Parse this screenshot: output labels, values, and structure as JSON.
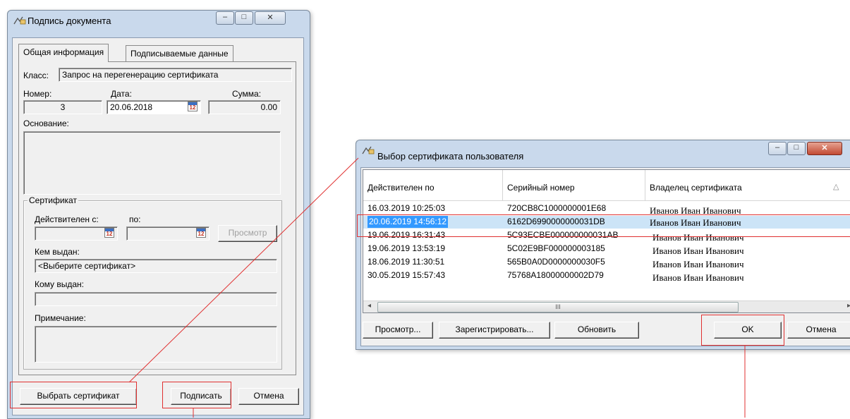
{
  "sign_dialog": {
    "title": "Подпись документа",
    "tabs": [
      "Общая информация",
      "Подписываемые данные"
    ],
    "class_label": "Класс:",
    "class_value": "Запрос на перегенерацию сертификата",
    "number_label": "Номер:",
    "number_value": "3",
    "date_label": "Дата:",
    "date_value": "20.06.2018",
    "sum_label": "Сумма:",
    "sum_value": "0.00",
    "basis_label": "Основание:",
    "cert_group_title": "Сертификат",
    "valid_from_label": "Действителен с:",
    "valid_to_label": "по:",
    "view_button": "Просмотр",
    "issued_by_label": "Кем выдан:",
    "issued_by_value": "<Выберите сертификат>",
    "issued_to_label": "Кому выдан:",
    "note_label": "Примечание:",
    "select_cert_button": "Выбрать сертификат",
    "sign_button": "Подписать",
    "cancel_button": "Отмена",
    "calendar_glyph": "12"
  },
  "cert_dialog": {
    "title": "Выбор сертификата пользователя",
    "columns": [
      "Действителен по",
      "Серийный номер",
      "Владелец сертификата"
    ],
    "rows": [
      {
        "valid": "16.03.2019 10:25:03",
        "serial": "720CB8C1000000001E68",
        "owner": "Иванов Иван Иванович"
      },
      {
        "valid": "20.06.2019 14:56:12",
        "serial": "6162D6990000000031DB",
        "owner": "Иванов Иван Иванович"
      },
      {
        "valid": "19.06.2019 16:31:43",
        "serial": "5C93ECBE000000000031AB",
        "owner": "Иванов Иван Иванович"
      },
      {
        "valid": "19.06.2019 13:53:19",
        "serial": "5C02E9BF000000003185",
        "owner": "Иванов Иван Иванович"
      },
      {
        "valid": "18.06.2019 11:30:51",
        "serial": "565B0A0D0000000030F5",
        "owner": "Иванов Иван Иванович"
      },
      {
        "valid": "30.05.2019 15:57:43",
        "serial": "75768A18000000002D79",
        "owner": "Иванов Иван Иванович"
      }
    ],
    "selected_row": 1,
    "scroll_glyph": "III",
    "view_button": "Просмотр...",
    "register_button": "Зарегистрировать...",
    "refresh_button": "Обновить",
    "ok_button": "OK",
    "cancel_button": "Отмена"
  },
  "colors": {
    "selection": "#3399ff",
    "row_highlight": "#cce4f7",
    "annotation": "#e03030"
  }
}
